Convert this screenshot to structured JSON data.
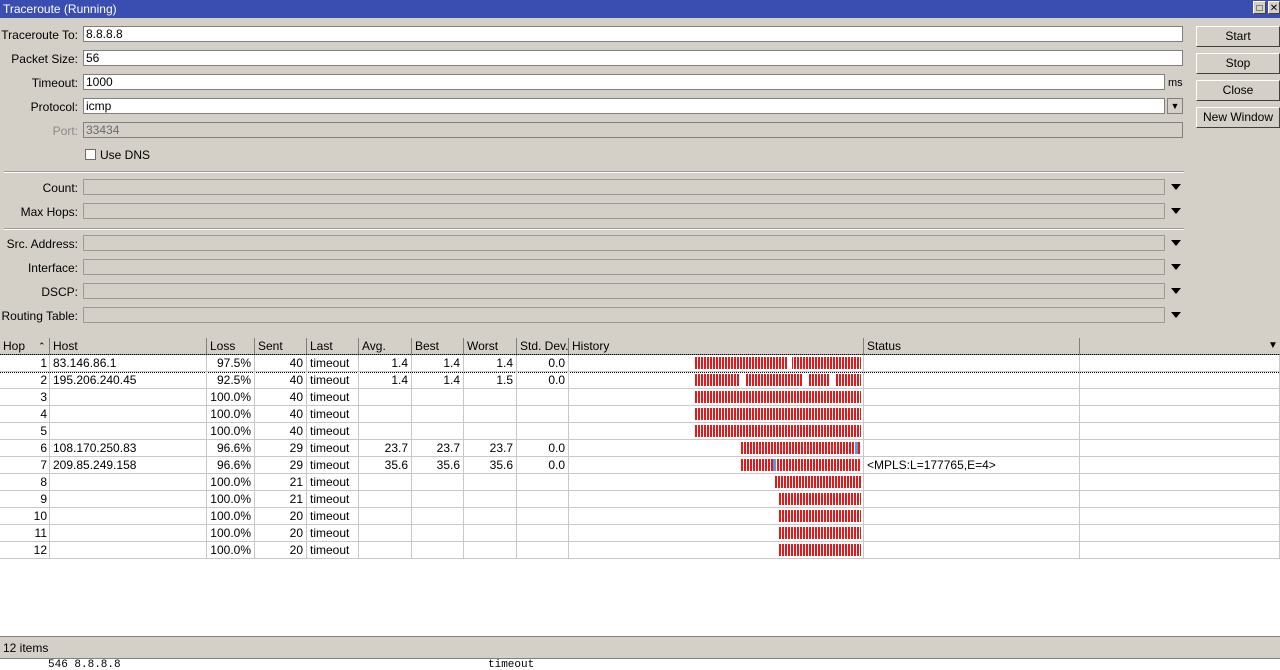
{
  "window": {
    "title": "Traceroute (Running)"
  },
  "form": {
    "traceroute_to": {
      "label": "Traceroute To:",
      "value": "8.8.8.8"
    },
    "packet_size": {
      "label": "Packet Size:",
      "value": "56"
    },
    "timeout": {
      "label": "Timeout:",
      "value": "1000",
      "unit": "ms"
    },
    "protocol": {
      "label": "Protocol:",
      "value": "icmp"
    },
    "port": {
      "label": "Port:",
      "value": "33434"
    },
    "use_dns": {
      "label": "Use DNS",
      "checked": false
    },
    "count": {
      "label": "Count:"
    },
    "max_hops": {
      "label": "Max Hops:"
    },
    "src_address": {
      "label": "Src. Address:"
    },
    "interface": {
      "label": "Interface:"
    },
    "dscp": {
      "label": "DSCP:"
    },
    "routing_table": {
      "label": "Routing Table:"
    }
  },
  "buttons": {
    "start": "Start",
    "stop": "Stop",
    "close": "Close",
    "new_window": "New Window"
  },
  "table": {
    "headers": {
      "hop": "Hop",
      "host": "Host",
      "loss": "Loss",
      "sent": "Sent",
      "last": "Last",
      "avg": "Avg.",
      "best": "Best",
      "worst": "Worst",
      "std": "Std. Dev.",
      "history": "History",
      "status": "Status"
    },
    "rows": [
      {
        "hop": "1",
        "host": "83.146.86.1",
        "loss": "97.5%",
        "sent": "40",
        "last": "timeout",
        "avg": "1.4",
        "best": "1.4",
        "worst": "1.4",
        "std": "0.0",
        "status": ""
      },
      {
        "hop": "2",
        "host": "195.206.240.45",
        "loss": "92.5%",
        "sent": "40",
        "last": "timeout",
        "avg": "1.4",
        "best": "1.4",
        "worst": "1.5",
        "std": "0.0",
        "status": ""
      },
      {
        "hop": "3",
        "host": "",
        "loss": "100.0%",
        "sent": "40",
        "last": "timeout",
        "avg": "",
        "best": "",
        "worst": "",
        "std": "",
        "status": ""
      },
      {
        "hop": "4",
        "host": "",
        "loss": "100.0%",
        "sent": "40",
        "last": "timeout",
        "avg": "",
        "best": "",
        "worst": "",
        "std": "",
        "status": ""
      },
      {
        "hop": "5",
        "host": "",
        "loss": "100.0%",
        "sent": "40",
        "last": "timeout",
        "avg": "",
        "best": "",
        "worst": "",
        "std": "",
        "status": ""
      },
      {
        "hop": "6",
        "host": "108.170.250.83",
        "loss": "96.6%",
        "sent": "29",
        "last": "timeout",
        "avg": "23.7",
        "best": "23.7",
        "worst": "23.7",
        "std": "0.0",
        "status": ""
      },
      {
        "hop": "7",
        "host": "209.85.249.158",
        "loss": "96.6%",
        "sent": "29",
        "last": "timeout",
        "avg": "35.6",
        "best": "35.6",
        "worst": "35.6",
        "std": "0.0",
        "status": "<MPLS:L=177765,E=4>"
      },
      {
        "hop": "8",
        "host": "",
        "loss": "100.0%",
        "sent": "21",
        "last": "timeout",
        "avg": "",
        "best": "",
        "worst": "",
        "std": "",
        "status": ""
      },
      {
        "hop": "9",
        "host": "",
        "loss": "100.0%",
        "sent": "21",
        "last": "timeout",
        "avg": "",
        "best": "",
        "worst": "",
        "std": "",
        "status": ""
      },
      {
        "hop": "10",
        "host": "",
        "loss": "100.0%",
        "sent": "20",
        "last": "timeout",
        "avg": "",
        "best": "",
        "worst": "",
        "std": "",
        "status": ""
      },
      {
        "hop": "11",
        "host": "",
        "loss": "100.0%",
        "sent": "20",
        "last": "timeout",
        "avg": "",
        "best": "",
        "worst": "",
        "std": "",
        "status": ""
      },
      {
        "hop": "12",
        "host": "",
        "loss": "100.0%",
        "sent": "20",
        "last": "timeout",
        "avg": "",
        "best": "",
        "worst": "",
        "std": "",
        "status": ""
      }
    ]
  },
  "history_colors": {
    "loss": "#e51919",
    "reply": "#5b9bd5"
  },
  "status_bar": {
    "items": "12 items"
  },
  "bottom_strip": {
    "left": "546 8.8.8.8",
    "right": "timeout"
  }
}
